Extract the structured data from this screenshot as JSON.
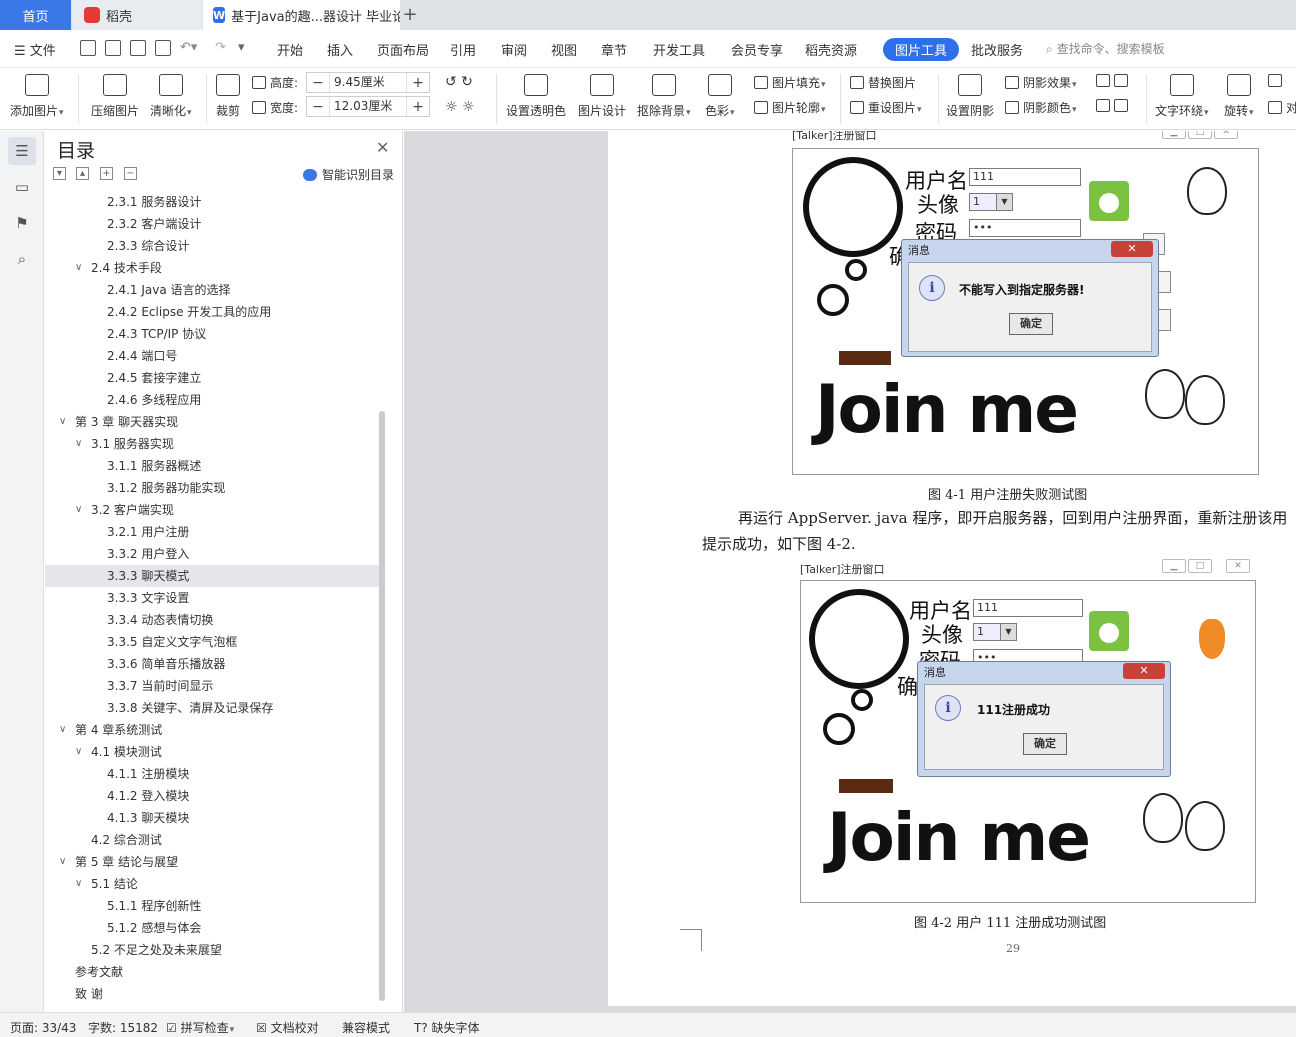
{
  "tabs": {
    "home": "首页",
    "docer": "稻壳",
    "document": "基于Java的趣...器设计 毕业论文"
  },
  "menu": {
    "file": "文件",
    "items": [
      "开始",
      "插入",
      "页面布局",
      "引用",
      "审阅",
      "视图",
      "章节",
      "开发工具",
      "会员专享",
      "稻壳资源",
      "图片工具",
      "批改服务"
    ],
    "active": "图片工具",
    "search_placeholder": "查找命令、搜索模板"
  },
  "ribbon": {
    "add_image": "添加图片",
    "compress_image": "压缩图片",
    "sharpen": "清晰化",
    "crop": "裁剪",
    "height_label": "高度:",
    "height_value": "9.45厘米",
    "width_label": "宽度:",
    "width_value": "12.03厘米",
    "set_transparent": "设置透明色",
    "image_design": "图片设计",
    "remove_bg": "抠除背景",
    "color": "色彩",
    "image_fill": "图片填充",
    "image_outline": "图片轮廓",
    "replace_image": "替换图片",
    "reset_image": "重设图片",
    "set_shadow": "设置阴影",
    "shadow_effect": "阴影效果",
    "shadow_color": "阴影颜色",
    "text_wrap": "文字环绕",
    "rotate": "旋转",
    "align_partial": "对"
  },
  "toc": {
    "title": "目录",
    "smart": "智能识别目录",
    "items": [
      {
        "text": "2.3.1  服务器设计",
        "level": 3
      },
      {
        "text": "2.3.2  客户端设计",
        "level": 3
      },
      {
        "text": "2.3.3  综合设计",
        "level": 3
      },
      {
        "text": "2.4  技术手段",
        "level": 2,
        "expanded": true
      },
      {
        "text": "2.4.1 Java 语言的选择",
        "level": 3
      },
      {
        "text": "2.4.2 Eclipse 开发工具的应用",
        "level": 3
      },
      {
        "text": "2.4.3 TCP/IP 协议",
        "level": 3
      },
      {
        "text": "2.4.4  端口号",
        "level": 3
      },
      {
        "text": "2.4.5  套接字建立",
        "level": 3
      },
      {
        "text": "2.4.6  多线程应用",
        "level": 3
      },
      {
        "text": "第 3 章  聊天器实现",
        "level": 1,
        "expanded": true
      },
      {
        "text": "3.1  服务器实现",
        "level": 2,
        "expanded": true
      },
      {
        "text": "3.1.1  服务器概述",
        "level": 3
      },
      {
        "text": "3.1.2  服务器功能实现",
        "level": 3
      },
      {
        "text": "3.2  客户端实现",
        "level": 2,
        "expanded": true
      },
      {
        "text": "3.2.1  用户注册",
        "level": 3
      },
      {
        "text": "3.3.2  用户登入",
        "level": 3
      },
      {
        "text": "3.3.3  聊天模式",
        "level": 3,
        "selected": true
      },
      {
        "text": "3.3.3  文字设置",
        "level": 3
      },
      {
        "text": "3.3.4  动态表情切换",
        "level": 3
      },
      {
        "text": "3.3.5  自定义文字气泡框",
        "level": 3
      },
      {
        "text": "3.3.6  简单音乐播放器",
        "level": 3
      },
      {
        "text": "3.3.7  当前时间显示",
        "level": 3
      },
      {
        "text": "3.3.8  关键字、清屏及记录保存",
        "level": 3
      },
      {
        "text": "第 4 章系统测试",
        "level": 1,
        "expanded": true
      },
      {
        "text": "4.1  模块测试",
        "level": 2,
        "expanded": true
      },
      {
        "text": "4.1.1  注册模块",
        "level": 3
      },
      {
        "text": "4.1.2  登入模块",
        "level": 3
      },
      {
        "text": "4.1.3  聊天模块",
        "level": 3
      },
      {
        "text": "4.2  综合测试",
        "level": 2
      },
      {
        "text": "第 5 章  结论与展望",
        "level": 1,
        "expanded": true
      },
      {
        "text": "5.1  结论",
        "level": 2,
        "expanded": true
      },
      {
        "text": "5.1.1  程序创新性",
        "level": 3
      },
      {
        "text": "5.1.2  感想与体会",
        "level": 3
      },
      {
        "text": "5.2  不足之处及未来展望",
        "level": 2
      },
      {
        "text": "参考文献",
        "level": 1
      },
      {
        "text": "致    谢",
        "level": 1
      }
    ]
  },
  "document": {
    "figure1": {
      "window_title": "[Talker]注册窗口",
      "username_label": "用户名",
      "avatar_label": "头像",
      "password_label": "密码",
      "confirm_partial": "确",
      "username_value": "111",
      "avatar_value": "1",
      "password_value": "•••",
      "slogan": "Join me",
      "dialog_title": "消息",
      "dialog_message": "不能写入到指定服务器!",
      "dialog_ok": "确定",
      "caption": "图 4-1  用户注册失败测试图"
    },
    "paragraph_line1": "再运行 AppServer. java 程序，即开启服务器，回到用户注册界面，重新注册该用",
    "paragraph_line2": "提示成功，如下图 4-2.",
    "figure2": {
      "window_title": "[Talker]注册窗口",
      "username_label": "用户名",
      "avatar_label": "头像",
      "password_label": "密码",
      "confirm_partial": "确",
      "username_value": "111",
      "avatar_value": "1",
      "password_value": "•••",
      "slogan": "Join me",
      "dialog_title": "消息",
      "dialog_message": "111注册成功",
      "dialog_ok": "确定",
      "caption": "图 4-2  用户 111 注册成功测试图"
    },
    "page_number": "29"
  },
  "status": {
    "page": "页面: 33/43",
    "words": "字数: 15182",
    "spell": "拼写检查",
    "proof": "文档校对",
    "compat": "兼容模式",
    "missing_font": "缺失字体"
  },
  "colors": {
    "accent": "#2f6fea",
    "home_tab": "#3b78e7",
    "dialog_close": "#c9423a"
  }
}
